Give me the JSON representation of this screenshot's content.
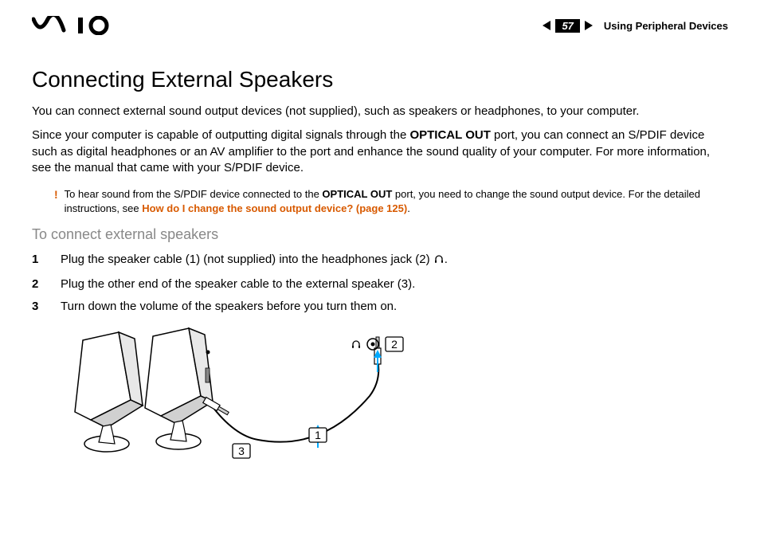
{
  "header": {
    "page_number": "57",
    "section": "Using Peripheral Devices"
  },
  "title": "Connecting External Speakers",
  "para1": "You can connect external sound output devices (not supplied), such as speakers or headphones, to your computer.",
  "para2_a": "Since your computer is capable of outputting digital signals through the ",
  "para2_bold": "OPTICAL OUT",
  "para2_b": " port, you can connect an S/PDIF device such as digital headphones or an AV amplifier to the port and enhance the sound quality of your computer. For more information, see the manual that came with your S/PDIF device.",
  "note": {
    "bang": "!",
    "text_a": "To hear sound from the S/PDIF device connected to the ",
    "text_bold": "OPTICAL OUT",
    "text_b": " port, you need to change the sound output device. For the detailed instructions, see ",
    "link_a": "How do I change the sound output device? ",
    "link_b": "(page 125)",
    "text_c": "."
  },
  "subheading": "To connect external speakers",
  "steps": [
    {
      "a": "Plug the speaker cable (1) (not supplied) into the headphones jack (2) ",
      "b": "."
    },
    {
      "a": "Plug the other end of the speaker cable to the external speaker (3).",
      "b": ""
    },
    {
      "a": "Turn down the volume of the speakers before you turn them on.",
      "b": ""
    }
  ],
  "diagram": {
    "label1": "1",
    "label2": "2",
    "label3": "3"
  }
}
